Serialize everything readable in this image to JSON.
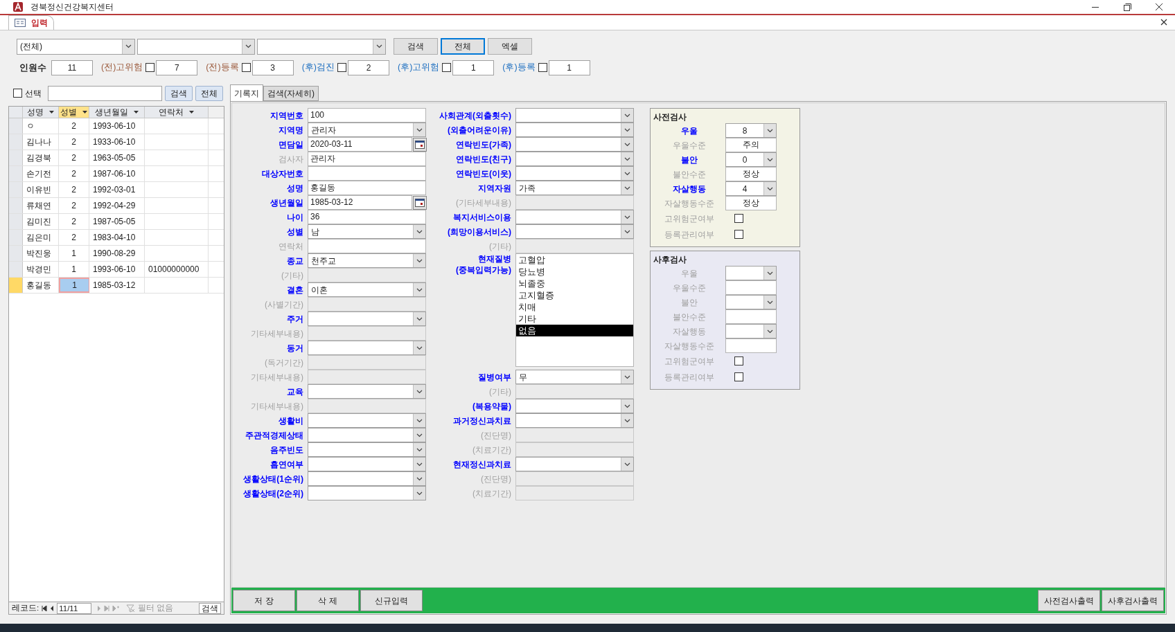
{
  "window": {
    "title": "경북정신건강복지센터"
  },
  "document_tab": {
    "label": "입력"
  },
  "filter_combo": {
    "value": "(전체)"
  },
  "top_buttons": [
    {
      "label": "검색",
      "focused": false
    },
    {
      "label": "전체",
      "focused": true
    },
    {
      "label": "엑셀",
      "focused": false
    }
  ],
  "counts": {
    "label": "인원수",
    "value": "11",
    "items": [
      {
        "label": "(전)고위험",
        "kind": "pre",
        "checked": false,
        "value": "7"
      },
      {
        "label": "(전)등록",
        "kind": "pre",
        "checked": false,
        "value": "3"
      },
      {
        "label": "(후)검진",
        "kind": "post",
        "checked": false,
        "value": "2"
      },
      {
        "label": "(후)고위험",
        "kind": "post",
        "checked": false,
        "value": "1"
      },
      {
        "label": "(후)등록",
        "kind": "post",
        "checked": false,
        "value": "1"
      }
    ]
  },
  "list_panel": {
    "select": {
      "label": "선택",
      "checked": false
    },
    "buttons": [
      "검색",
      "전체"
    ],
    "columns": [
      {
        "label": "성명",
        "filtered": false
      },
      {
        "label": "성별",
        "filtered": true
      },
      {
        "label": "생년월일",
        "filtered": false
      },
      {
        "label": "연락처",
        "filtered": false
      }
    ],
    "rows": [
      {
        "selected": false,
        "cells": [
          {
            "text": "ㅇ",
            "focused": false
          },
          {
            "text": "2",
            "focused": false
          },
          {
            "text": "1993-06-10",
            "focused": false
          },
          {
            "focused": false
          }
        ]
      },
      {
        "selected": false,
        "cells": [
          {
            "text": "김나나",
            "focused": false
          },
          {
            "text": "2",
            "focused": false
          },
          {
            "text": "1933-06-10",
            "focused": false
          },
          {
            "focused": false
          }
        ]
      },
      {
        "selected": false,
        "cells": [
          {
            "text": "김경북",
            "focused": false
          },
          {
            "text": "2",
            "focused": false
          },
          {
            "text": "1963-05-05",
            "focused": false
          },
          {
            "focused": false
          }
        ]
      },
      {
        "selected": false,
        "cells": [
          {
            "text": "손기전",
            "focused": false
          },
          {
            "text": "2",
            "focused": false
          },
          {
            "text": "1987-06-10",
            "focused": false
          },
          {
            "focused": false
          }
        ]
      },
      {
        "selected": false,
        "cells": [
          {
            "text": "이유빈",
            "focused": false
          },
          {
            "text": "2",
            "focused": false
          },
          {
            "text": "1992-03-01",
            "focused": false
          },
          {
            "focused": false
          }
        ]
      },
      {
        "selected": false,
        "cells": [
          {
            "text": "류채연",
            "focused": false
          },
          {
            "text": "2",
            "focused": false
          },
          {
            "text": "1992-04-29",
            "focused": false
          },
          {
            "focused": false
          }
        ]
      },
      {
        "selected": false,
        "cells": [
          {
            "text": "김미진",
            "focused": false
          },
          {
            "text": "2",
            "focused": false
          },
          {
            "text": "1987-05-05",
            "focused": false
          },
          {
            "focused": false
          }
        ]
      },
      {
        "selected": false,
        "cells": [
          {
            "text": "김은미",
            "focused": false
          },
          {
            "text": "2",
            "focused": false
          },
          {
            "text": "1983-04-10",
            "focused": false
          },
          {
            "focused": false
          }
        ]
      },
      {
        "selected": false,
        "cells": [
          {
            "text": "박진웅",
            "focused": false
          },
          {
            "text": "1",
            "focused": false
          },
          {
            "text": "1990-08-29",
            "focused": false
          },
          {
            "focused": false
          }
        ]
      },
      {
        "selected": false,
        "cells": [
          {
            "text": "박경민",
            "focused": false
          },
          {
            "text": "1",
            "focused": false
          },
          {
            "text": "1993-06-10",
            "focused": false
          },
          {
            "text": "01000000000",
            "focused": false
          }
        ]
      },
      {
        "selected": true,
        "cells": [
          {
            "text": "홍길동",
            "focused": false
          },
          {
            "text": "1",
            "focused": true
          },
          {
            "text": "1985-03-12",
            "focused": false
          },
          {
            "focused": false
          }
        ]
      }
    ],
    "navigation": {
      "label": "레코드:",
      "position": "11/11",
      "filter": "필터 없음",
      "search": "검색"
    }
  },
  "form_tabs": [
    {
      "label": "기록지",
      "selected": true
    },
    {
      "label": "검색(자세히)",
      "selected": false
    }
  ],
  "left_fields": [
    {
      "label": "지역번호",
      "highlighted": true,
      "kind": "text",
      "value": "100"
    },
    {
      "label": "지역명",
      "highlighted": true,
      "kind": "combo",
      "value": "관리자"
    },
    {
      "label": "면담일",
      "highlighted": true,
      "kind": "date",
      "value": "2020-03-11"
    },
    {
      "label": "검사자",
      "highlighted": false,
      "kind": "text",
      "value": "관리자"
    },
    {
      "label": "대상자번호",
      "highlighted": true,
      "kind": "text"
    },
    {
      "label": "성명",
      "highlighted": true,
      "kind": "text",
      "value": "홍길동"
    },
    {
      "label": "생년월일",
      "highlighted": true,
      "kind": "date",
      "value": "1985-03-12"
    },
    {
      "label": "나이",
      "highlighted": true,
      "kind": "text",
      "value": "36"
    },
    {
      "label": "성별",
      "highlighted": true,
      "kind": "combo",
      "value": "남"
    },
    {
      "label": "연락처",
      "highlighted": false,
      "kind": "text"
    },
    {
      "label": "종교",
      "highlighted": true,
      "kind": "combo",
      "value": "천주교"
    },
    {
      "label": "(기타)",
      "highlighted": false,
      "kind": "locked"
    },
    {
      "label": "결혼",
      "highlighted": true,
      "kind": "combo",
      "value": "이혼"
    },
    {
      "label": "(사별기간)",
      "highlighted": false,
      "kind": "locked"
    },
    {
      "label": "주거",
      "highlighted": true,
      "kind": "combo"
    },
    {
      "label": "기타세부내용)",
      "highlighted": false,
      "kind": "locked"
    },
    {
      "label": "동거",
      "highlighted": true,
      "kind": "combo"
    },
    {
      "label": "(독거기간)",
      "highlighted": false,
      "kind": "locked"
    },
    {
      "label": "기타세부내용)",
      "highlighted": false,
      "kind": "locked"
    },
    {
      "label": "교육",
      "highlighted": true,
      "kind": "combo"
    },
    {
      "label": "기타세부내용)",
      "highlighted": false,
      "kind": "locked"
    },
    {
      "label": "생활비",
      "highlighted": true,
      "kind": "combo"
    },
    {
      "label": "주관적경제상태",
      "highlighted": true,
      "kind": "combo"
    },
    {
      "label": "음주빈도",
      "highlighted": true,
      "kind": "combo"
    },
    {
      "label": "흡연여부",
      "highlighted": true,
      "kind": "combo"
    },
    {
      "label": "생활상태(1순위)",
      "highlighted": true,
      "kind": "combo"
    },
    {
      "label": "생활상태(2순위)",
      "highlighted": true,
      "kind": "combo"
    }
  ],
  "middle_fields": [
    {
      "label": "사회관계(외출횟수)",
      "highlighted": true,
      "kind": "combo"
    },
    {
      "label": "(외출어려운이유)",
      "highlighted": true,
      "kind": "combo"
    },
    {
      "label": "연락빈도(가족)",
      "highlighted": true,
      "kind": "combo"
    },
    {
      "label": "연락빈도(친구)",
      "highlighted": true,
      "kind": "combo"
    },
    {
      "label": "연락빈도(이웃)",
      "highlighted": true,
      "kind": "combo"
    },
    {
      "label": "지역자원",
      "highlighted": true,
      "kind": "combo",
      "value": "가족"
    },
    {
      "label": "(기타세부내용)",
      "highlighted": false,
      "kind": "locked"
    },
    {
      "label": "복지서비스이용",
      "highlighted": true,
      "kind": "combo"
    },
    {
      "label": "(희망이용서비스)",
      "highlighted": true,
      "kind": "combo"
    },
    {
      "label": "(기타)",
      "highlighted": false,
      "kind": "locked"
    },
    {
      "label": "현재질병\n(중복입력가능)",
      "highlighted": true,
      "kind": "listbox",
      "options": [
        {
          "label": "고혈압",
          "selected": false
        },
        {
          "label": "당뇨병",
          "selected": false
        },
        {
          "label": "뇌졸중",
          "selected": false
        },
        {
          "label": "고지혈증",
          "selected": false
        },
        {
          "label": "치매",
          "selected": false
        },
        {
          "label": "기타",
          "selected": false
        },
        {
          "label": "없음",
          "selected": true
        }
      ]
    },
    {
      "label": "질병여부",
      "highlighted": true,
      "kind": "combo",
      "value": "무"
    },
    {
      "label": "(기타)",
      "highlighted": false,
      "kind": "locked"
    },
    {
      "label": "(복용약물)",
      "highlighted": true,
      "kind": "combo"
    },
    {
      "label": "과거정신과치료",
      "highlighted": true,
      "kind": "combo"
    },
    {
      "label": "(진단명)",
      "highlighted": false,
      "kind": "locked"
    },
    {
      "label": "(치료기간)",
      "highlighted": false,
      "kind": "locked"
    },
    {
      "label": "현재정신과치료",
      "highlighted": true,
      "kind": "combo"
    },
    {
      "label": "(진단명)",
      "highlighted": false,
      "kind": "locked"
    },
    {
      "label": "(치료기간)",
      "highlighted": false,
      "kind": "locked"
    }
  ],
  "test_panels": [
    {
      "title": "사전검사",
      "kind": "pre",
      "rows": [
        {
          "label": "우울",
          "highlighted": true,
          "kind": "combo",
          "value": "8"
        },
        {
          "label": "우울수준",
          "highlighted": false,
          "kind": "text",
          "value": "주의"
        },
        {
          "label": "불안",
          "highlighted": true,
          "kind": "combo",
          "value": "0"
        },
        {
          "label": "불안수준",
          "highlighted": false,
          "kind": "text",
          "value": "정상"
        },
        {
          "label": "자살행동",
          "highlighted": true,
          "kind": "combo",
          "value": "4"
        },
        {
          "label": "자살행동수준",
          "highlighted": false,
          "kind": "text",
          "value": "정상"
        },
        {
          "label": "고위험군여부",
          "highlighted": false,
          "kind": "checkbox",
          "checked": false
        },
        {
          "label": "등록관리여부",
          "highlighted": false,
          "kind": "checkbox",
          "checked": false
        }
      ]
    },
    {
      "title": "사후검사",
      "kind": "post",
      "rows": [
        {
          "label": "우울",
          "highlighted": false,
          "kind": "combo"
        },
        {
          "label": "우울수준",
          "highlighted": false,
          "kind": "text"
        },
        {
          "label": "불안",
          "highlighted": false,
          "kind": "combo"
        },
        {
          "label": "불안수준",
          "highlighted": false,
          "kind": "text"
        },
        {
          "label": "자살행동",
          "highlighted": false,
          "kind": "combo"
        },
        {
          "label": "자살행동수준",
          "highlighted": false,
          "kind": "text"
        },
        {
          "label": "고위험군여부",
          "highlighted": false,
          "kind": "checkbox",
          "checked": false
        },
        {
          "label": "등록관리여부",
          "highlighted": false,
          "kind": "checkbox",
          "checked": false
        }
      ]
    }
  ],
  "action_buttons": {
    "left": [
      "저 장",
      "삭 제",
      "신규입력"
    ],
    "right": [
      "사전검사출력",
      "사후검사출력"
    ]
  }
}
